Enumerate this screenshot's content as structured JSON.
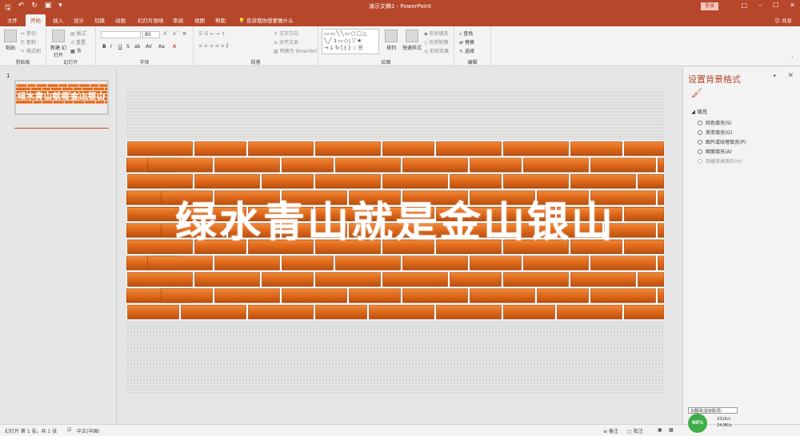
{
  "titlebar": {
    "doc_title": "演示文稿1  -  PowerPoint",
    "login": "登录"
  },
  "tabs": [
    {
      "label": "文件"
    },
    {
      "label": "开始",
      "active": true
    },
    {
      "label": "插入"
    },
    {
      "label": "设计"
    },
    {
      "label": "切换"
    },
    {
      "label": "动画"
    },
    {
      "label": "幻灯片放映"
    },
    {
      "label": "审阅"
    },
    {
      "label": "视图"
    },
    {
      "label": "帮助"
    }
  ],
  "tell_me": "告诉我你想要做什么",
  "share": "共享",
  "ribbon": {
    "clipboard": {
      "label": "剪贴板",
      "paste": "粘贴",
      "cut": "剪切",
      "copy": "复制",
      "format_painter": "格式刷"
    },
    "slides": {
      "label": "幻灯片",
      "new_slide": "新建\n幻灯片",
      "layout": "版式",
      "reset": "重置",
      "section": "节"
    },
    "font": {
      "label": "字体",
      "size": "80"
    },
    "paragraph": {
      "label": "段落",
      "text_direction": "文字方向",
      "align_text": "对齐文本",
      "smartart": "转换为 SmartArt"
    },
    "drawing": {
      "label": "绘图",
      "arrange": "排列",
      "quick_styles": "快速样式",
      "shape_fill": "形状填充",
      "shape_outline": "形状轮廓",
      "shape_effects": "形状效果"
    },
    "editing": {
      "label": "编辑",
      "find": "查找",
      "replace": "替换",
      "select": "选择"
    }
  },
  "thumbnail": {
    "number": "1",
    "text": "绿水青山就是金山银山"
  },
  "slide": {
    "title": "绿水青山就是金山银山"
  },
  "format_pane": {
    "title": "设置背景格式",
    "section": "填充",
    "options": [
      {
        "label": "纯色填充(S)",
        "dim": false
      },
      {
        "label": "渐变填充(G)",
        "dim": false
      },
      {
        "label": "图片或纹理填充(P)",
        "dim": false
      },
      {
        "label": "图案填充(A)",
        "dim": false
      },
      {
        "label": "隐藏背景图形(H)",
        "dim": true
      }
    ]
  },
  "statusbar": {
    "slide_info": "幻灯片 第 1 张，共 1 张",
    "language": "中文(中国)",
    "notes": "备注",
    "comments": "批注"
  },
  "net": {
    "percent": "60%",
    "up": "331K/s",
    "down": "24.8K/s",
    "tip": "云翻译(鼠标取词)"
  },
  "colors": {
    "accent": "#b7472a",
    "brick": "#e06a1c",
    "mortar": "#ffffff"
  }
}
